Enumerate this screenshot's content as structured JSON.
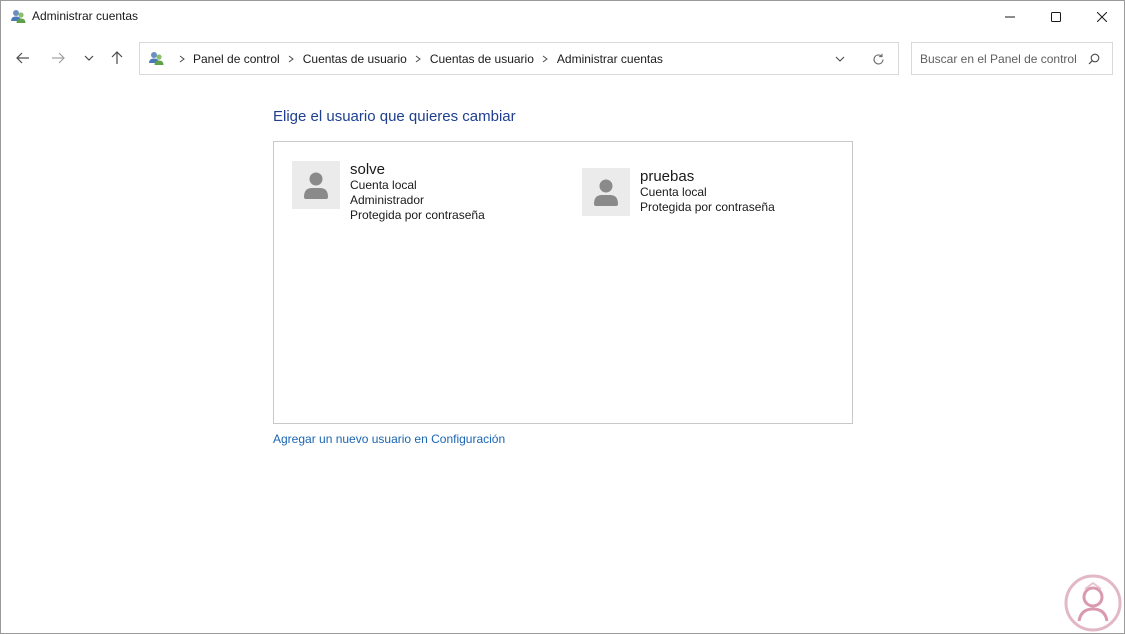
{
  "window": {
    "title": "Administrar cuentas"
  },
  "nav": {
    "back": "back-arrow-icon",
    "forward": "forward-arrow-icon",
    "recent": "chevron-down-icon",
    "up": "up-arrow-icon"
  },
  "address": {
    "crumbs": [
      "Panel de control",
      "Cuentas de usuario",
      "Cuentas de usuario",
      "Administrar cuentas"
    ]
  },
  "search": {
    "placeholder": "Buscar en el Panel de control"
  },
  "main": {
    "heading": "Elige el usuario que quieres cambiar",
    "accounts": [
      {
        "name": "solve",
        "lines": [
          "Cuenta local",
          "Administrador",
          "Protegida por contraseña"
        ]
      },
      {
        "name": "pruebas",
        "lines": [
          "Cuenta local",
          "Protegida por contraseña"
        ]
      }
    ],
    "add_link": "Agregar un nuevo usuario en Configuración"
  },
  "colors": {
    "heading": "#1e3f8f",
    "link": "#1a66b3",
    "avatar_bg": "#ebebeb",
    "avatar_figure": "#8a8a8a"
  }
}
